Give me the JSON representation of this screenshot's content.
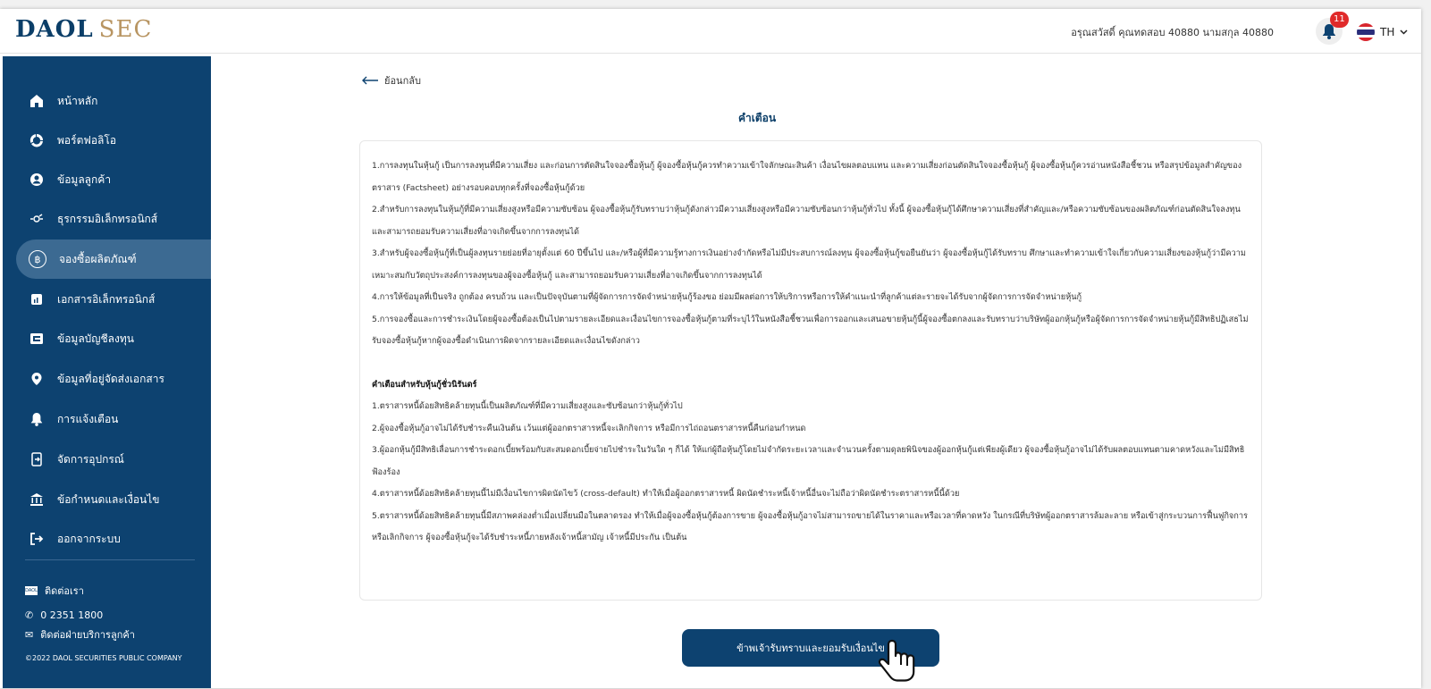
{
  "header": {
    "logo_primary": "DAOL",
    "logo_secondary": "SEC",
    "greeting": "อรุณสวัสดิ์ คุณทดสอบ 40880 นามสกุล 40880",
    "notification_count": "11",
    "language": "TH"
  },
  "sidebar": {
    "items": [
      {
        "label": "หน้าหลัก",
        "icon": "home-icon"
      },
      {
        "label": "พอร์ตฟอลิโอ",
        "icon": "portfolio-icon"
      },
      {
        "label": "ข้อมูลลูกค้า",
        "icon": "user-icon"
      },
      {
        "label": "ธุรกรรมอิเล็กทรอนิกส์",
        "icon": "transaction-icon"
      },
      {
        "label": "จองซื้อผลิตภัณฑ์",
        "icon": "coin-icon",
        "active": true
      },
      {
        "label": "เอกสารอิเล็กทรอนิกส์",
        "icon": "document-icon"
      },
      {
        "label": "ข้อมูลบัญชีลงทุน",
        "icon": "account-icon"
      },
      {
        "label": "ข้อมูลที่อยู่จัดส่งเอกสาร",
        "icon": "location-icon"
      },
      {
        "label": "การแจ้งเตือน",
        "icon": "bell-icon"
      },
      {
        "label": "จัดการอุปกรณ์",
        "icon": "device-icon"
      },
      {
        "label": "ข้อกำหนดและเงื่อนไข",
        "icon": "bank-icon"
      },
      {
        "label": "ออกจากระบบ",
        "icon": "logout-icon"
      }
    ],
    "contact_title": "ติดต่อเรา",
    "phone": "0 2351 1800",
    "support": "ติดต่อฝ่ายบริการลูกค้า",
    "copyright": "©2022 DAOL SECURITIES PUBLIC COMPANY"
  },
  "main": {
    "back_label": "ย้อนกลับ",
    "title": "คำเตือน",
    "warnings": [
      "1.การลงทุนในหุ้นกู้ เป็นการลงทุนที่มีความเสี่ยง และก่อนการตัดสินใจจองซื้อหุ้นกู้ ผู้จองซื้อหุ้นกู้ควรทำความเข้าใจลักษณะสินค้า เงื่อนไขผลตอบแทน และความเสี่ยงก่อนตัดสินใจจองซื้อหุ้นกู้ ผู้จองซื้อหุ้นกู้ควรอ่านหนังสือชี้ชวน หรือสรุปข้อมูลสำคัญของตราสาร (Factsheet) อย่างรอบคอบทุกครั้งที่จองซื้อหุ้นกู้ด้วย",
      "2.สำหรับการลงทุนในหุ้นกู้ที่มีความเสี่ยงสูงหรือมีความซับซ้อน ผู้จองซื้อหุ้นกู้รับทราบว่าหุ้นกู้ดังกล่าวมีความเสี่ยงสูงหรือมีความซับซ้อนกว่าหุ้นกู้ทั่วไป ทั้งนี้ ผู้จองซื้อหุ้นกู้ได้ศึกษาความเสี่ยงที่สำคัญและ/หรือความซับซ้อนของผลิตภัณฑ์ก่อนตัดสินใจลงทุนและสามารถยอมรับความเสี่ยงที่อาจเกิดขึ้นจากการลงทุนได้",
      "3.สำหรับผู้จองซื้อหุ้นกู้ที่เป็นผู้ลงทุนรายย่อยที่อายุตั้งแต่ 60 ปีขึ้นไป และ/หรือผู้ที่มีความรู้ทางการเงินอย่างจำกัดหรือไม่มีประสบการณ์ลงทุน ผู้จองซื้อหุ้นกู้ขอยืนยันว่า ผู้จองซื้อหุ้นกู้ได้รับทราบ ศึกษาและทำความเข้าใจเกี่ยวกับความเสี่ยงของหุ้นกู้ว่ามีความเหมาะสมกับวัตถุประสงค์การลงทุนของผู้จองซื้อหุ้นกู้ และสามารถยอมรับความเสี่ยงที่อาจเกิดขึ้นจากการลงทุนได้",
      "4.การให้ข้อมูลที่เป็นจริง ถูกต้อง ครบถ้วน และเป็นปัจจุบันตามที่ผู้จัดการการจัดจำหน่ายหุ้นกู้ร้องขอ ย่อมมีผลต่อการให้บริการหรือการให้คำแนะนำที่ลูกค้าแต่ละรายจะได้รับจากผู้จัดการการจัดจำหน่ายหุ้นกู้",
      "5.การจองซื้อและการชำระเงินโดยผู้จองซื้อต้องเป็นไปตามรายละเอียดและเงื่อนไขการจองซื้อหุ้นกู้ตามที่ระบุไว้ในหนังสือชี้ชวนเพื่อการออกและเสนอขายหุ้นกู้นี้ผู้จองซื้อตกลงและรับทราบว่าบริษัทผู้ออกหุ้นกู้หรือผู้จัดการการจัดจำหน่ายหุ้นกู้มีสิทธิปฏิเสธไม่รับจองซื้อหุ้นกู้หากผู้จองซื้อดำเนินการผิดจากรายละเอียดและเงื่อนไขดังกล่าว"
    ],
    "perpetual_title": "คำเตือนสำหรับหุ้นกู้ชั่วนิรันดร์",
    "perpetual_warnings": [
      "1.ตราสารหนี้ด้อยสิทธิคล้ายทุนนี้เป็นผลิตภัณฑ์ที่มีความเสี่ยงสูงและซับซ้อนกว่าหุ้นกู้ทั่วไป",
      "2.ผู้จองซื้อหุ้นกู้อาจไม่ได้รับชำระคืนเงินต้น เว้นแต่ผู้ออกตราสารหนี้จะเลิกกิจการ หรือมีการไถ่ถอนตราสารหนี้คืนก่อนกำหนด",
      "3.ผู้ออกหุ้นกู้มีสิทธิเลื่อนการชำระดอกเบี้ยพร้อมกับสะสมดอกเบี้ยจ่ายไปชำระในวันใด ๆ ก็ได้ ให้แก่ผู้ถือหุ้นกู้โดยไม่จำกัดระยะเวลาและจำนวนครั้งตามดุลยพินิจของผู้ออกหุ้นกู้แต่เพียงผู้เดียว ผู้จองซื้อหุ้นกู้อาจไม่ได้รับผลตอบแทนตามคาดหวังและไม่มีสิทธิฟ้องร้อง",
      "4.ตราสารหนี้ด้อยสิทธิคล้ายทุนนี้ไม่มีเงื่อนไขการผิดนัดไขว้ (cross-default) ทำให้เมื่อผู้ออกตราสารหนี้ ผิดนัดชำระหนี้เจ้าหนี้อื่นจะไม่ถือว่าผิดนัดชำระตราสารหนี้นี้ด้วย",
      "5.ตราสารหนี้ด้อยสิทธิคล้ายทุนนี้มีสภาพคล่องต่ำเมื่อเปลี่ยนมือในตลาดรอง ทำให้เมื่อผู้จองซื้อหุ้นกู้ต้องการขาย ผู้จองซื้อหุ้นกู้อาจไม่สามารถขายได้ในราคาและหรือเวลาที่คาดหวัง ในกรณีที่บริษัทผู้ออกตราสารล้มละลาย หรือเข้าสู่กระบวนการฟื้นฟูกิจการ หรือเลิกกิจการ ผู้จองซื้อหุ้นกู้จะได้รับชำระหนี้ภายหลังเจ้าหนี้สามัญ เจ้าหนี้มีประกัน เป็นต้น"
    ],
    "accept_button": "ข้าพเจ้ารับทราบและยอมรับเงื่อนไข"
  },
  "colors": {
    "brand_navy": "#0d4270",
    "brand_gold": "#b89562",
    "badge_red": "#e02a2a"
  }
}
